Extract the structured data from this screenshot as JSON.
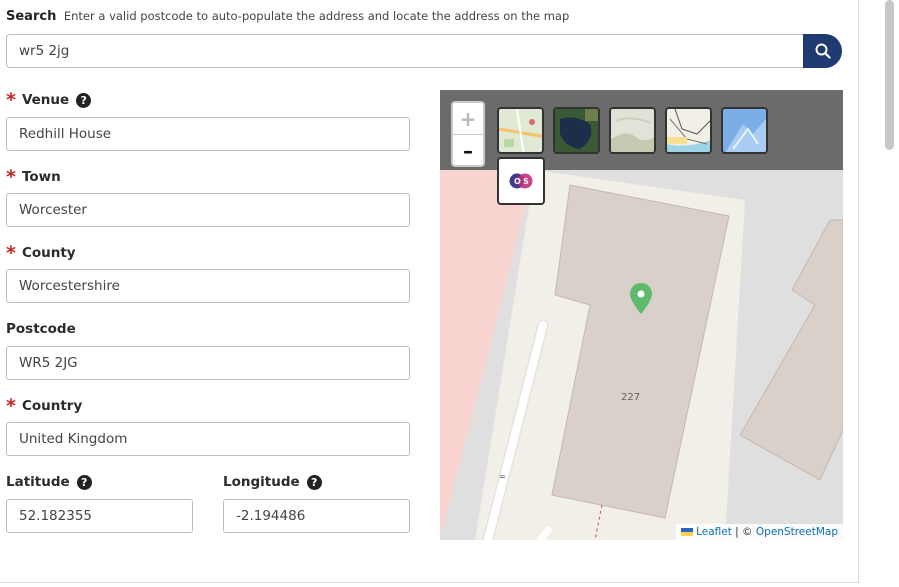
{
  "search": {
    "title": "Search",
    "help": "Enter a valid postcode to auto-populate the address and locate the address on the map",
    "value": "wr5 2jg",
    "button_icon": "search-icon"
  },
  "form": {
    "required_marker": "*",
    "help_glyph": "?",
    "venue": {
      "label": "Venue",
      "value": "Redhill House"
    },
    "town": {
      "label": "Town",
      "value": "Worcester"
    },
    "county": {
      "label": "County",
      "value": "Worcestershire"
    },
    "postcode": {
      "label": "Postcode",
      "value": "WR5 2JG"
    },
    "country": {
      "label": "Country",
      "value": "United Kingdom"
    },
    "latitude": {
      "label": "Latitude",
      "value": "52.182355"
    },
    "longitude": {
      "label": "Longitude",
      "value": "-2.194486"
    }
  },
  "map": {
    "zoom_in": "+",
    "zoom_out": "–",
    "building_number": "227",
    "layers": [
      "road-map-layer",
      "satellite-layer",
      "terrain-layer",
      "outdoor-layer",
      "relief-layer",
      "ordnance-survey-layer"
    ],
    "attribution": {
      "leaflet": "Leaflet",
      "sep": " | © ",
      "osm": "OpenStreetMap"
    },
    "colors": {
      "marker": "#5fba6b",
      "building": "#d9d0c9",
      "pink_area": "#f9d3d0"
    }
  }
}
